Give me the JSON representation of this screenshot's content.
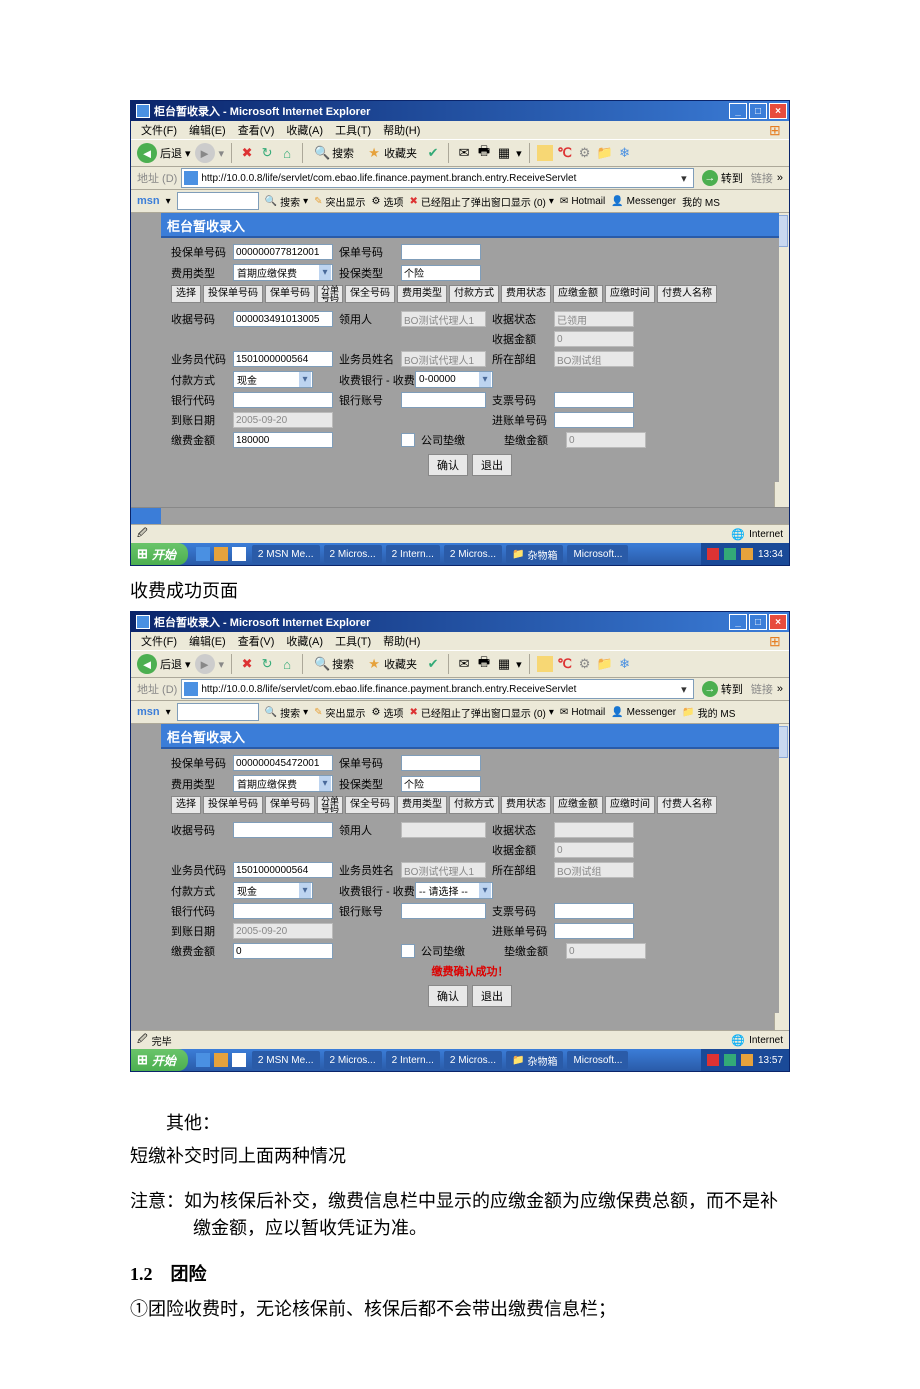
{
  "doc": {
    "caption1": "收费成功页面",
    "other_heading": "其他：",
    "other_line": "短缴补交时同上面两种情况",
    "note_heading": "注意：如为核保后补交，缴费信息栏中显示的应缴金额为应缴保费总额，而不是补缴金额，应以暂收凭证为准。",
    "sec12_heading": "1.2　团险",
    "sec12_line": "①团险收费时，无论核保前、核保后都不会带出缴费信息栏；"
  },
  "win": {
    "title": "柜台暂收录入 - Microsoft Internet Explorer",
    "menus": [
      "文件(F)",
      "编辑(E)",
      "查看(V)",
      "收藏(A)",
      "工具(T)",
      "帮助(H)"
    ],
    "back": "后退",
    "search": "搜索",
    "fav": "收藏夹",
    "addr_label": "地址 (D)",
    "url": "http://10.0.0.8/life/servlet/com.ebao.life.finance.payment.branch.entry.ReceiveServlet",
    "go": "转到",
    "links": "链接",
    "msn": {
      "logo": "msn",
      "search": "搜索",
      "highlight": "突出显示",
      "options": "选项",
      "blocked": "已经阻止了弹出窗口显示 (0)",
      "hotmail": "Hotmail",
      "messenger": "Messenger",
      "my": "我的 MS"
    },
    "status_done": "完毕",
    "status_internet": "Internet",
    "start": "开始",
    "tasks": [
      "2 MSN Me...",
      "2 Micros...",
      "2 Intern...",
      "2 Micros...",
      "杂物箱",
      "Microsoft..."
    ],
    "time1": "13:34",
    "time2": "13:57"
  },
  "form": {
    "title": "柜台暂收录入",
    "labels": {
      "proposal_no": "投保单号码",
      "policy_no": "保单号码",
      "fee_type": "费用类型",
      "ins_type": "投保类型",
      "select": "选择",
      "sub_no": "分单号码",
      "preserve_no": "保全号码",
      "pay_method_h": "付款方式",
      "fee_status_h": "费用状态",
      "due_amt_h": "应缴金额",
      "due_time_h": "应缴时间",
      "payer_h": "付费人名称",
      "receipt_no": "收据号码",
      "collector": "领用人",
      "receipt_status": "收据状态",
      "receipt_amt": "收据金额",
      "agent_code": "业务员代码",
      "agent_name": "业务员姓名",
      "dept": "所在部组",
      "pay_method": "付款方式",
      "bank_acct": "收费银行 - 收费账号",
      "bank_code": "银行代码",
      "bank_acct2": "银行账号",
      "cheque_no": "支票号码",
      "due_date": "到账日期",
      "entry_no": "进账单号码",
      "pay_amt": "缴费金额",
      "company_adv": "公司垫缴",
      "adv_amt": "垫缴金额",
      "confirm": "确认",
      "exit": "退出"
    },
    "values1": {
      "proposal_no": "000000077812001",
      "fee_type": "首期应缴保费",
      "ins_type": "个险",
      "receipt_no": "000003491013005",
      "collector": "BO测试代理人1",
      "receipt_status": "已领用",
      "receipt_amt": "0",
      "agent_code": "1501000000564",
      "agent_name": "BO测试代理人1",
      "dept": "BO测试组",
      "pay_method": "现金",
      "bank_acct": "0-00000",
      "due_date": "2005-09-20",
      "pay_amt": "180000",
      "adv_amt": "0"
    },
    "values2": {
      "proposal_no": "000000045472001",
      "fee_type": "首期应缴保费",
      "ins_type": "个险",
      "receipt_amt": "0",
      "agent_code": "1501000000564",
      "agent_name": "BO测试代理人1",
      "dept": "BO测试组",
      "pay_method": "现金",
      "bank_acct": "-- 请选择 --",
      "due_date": "2005-09-20",
      "pay_amt": "0",
      "adv_amt": "0",
      "success": "缴费确认成功！"
    }
  }
}
